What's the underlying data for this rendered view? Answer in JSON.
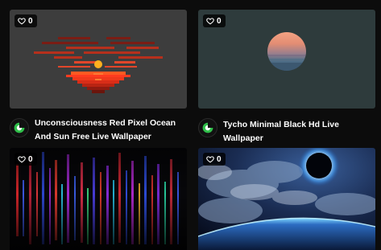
{
  "cards": [
    {
      "title": "Unconsciousness Red Pixel Ocean And Sun Free Live Wallpaper",
      "likes": "0"
    },
    {
      "title": "Tycho Minimal Black Hd Live Wallpaper",
      "likes": "0"
    },
    {
      "title": "",
      "likes": "0"
    },
    {
      "title": "",
      "likes": "0"
    }
  ],
  "colors": {
    "page_background": "#0c0c0c",
    "card_background_0": "#3d3d3d",
    "card_background_1": "#2e3b3c",
    "accent_green": "#2fbf4a"
  },
  "icons": {
    "likes": "heart-outline-icon",
    "avatar": "green-logo-icon"
  }
}
